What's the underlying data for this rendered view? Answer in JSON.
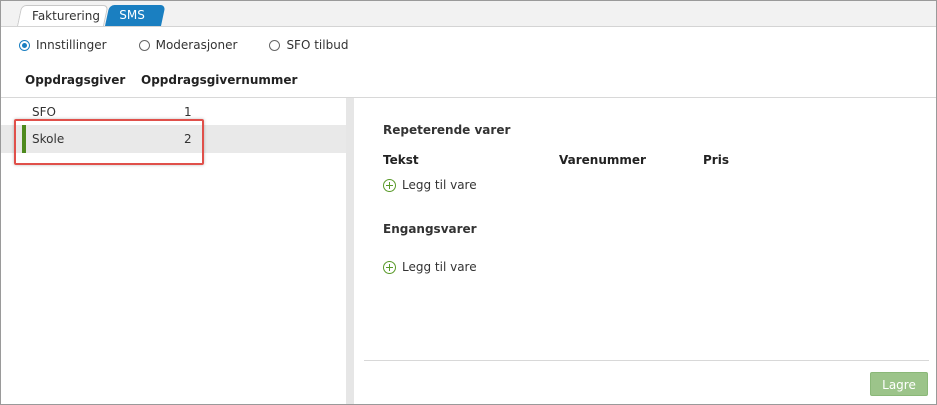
{
  "tabs": [
    {
      "label": "Fakturering",
      "active": true
    },
    {
      "label": "SMS",
      "active": false
    }
  ],
  "radios": [
    {
      "label": "Innstillinger",
      "selected": true
    },
    {
      "label": "Moderasjoner",
      "selected": false
    },
    {
      "label": "SFO tilbud",
      "selected": false
    }
  ],
  "list": {
    "headers": [
      "Oppdragsgiver",
      "Oppdragsgivernummer"
    ],
    "rows": [
      {
        "name": "SFO",
        "number": "1"
      },
      {
        "name": "Skole",
        "number": "2",
        "selected": true
      }
    ]
  },
  "detail": {
    "recurring_title": "Repeterende varer",
    "columns": [
      "Tekst",
      "Varenummer",
      "Pris"
    ],
    "add_item": "Legg til vare",
    "onetime_title": "Engangsvarer",
    "add_item_2": "Legg til vare",
    "save_label": "Lagre"
  },
  "colors": {
    "accent": "#1a7fc1",
    "selected_bar": "#4e8a1e",
    "highlight": "#e0504a",
    "save_disabled": "#9cc48a"
  }
}
